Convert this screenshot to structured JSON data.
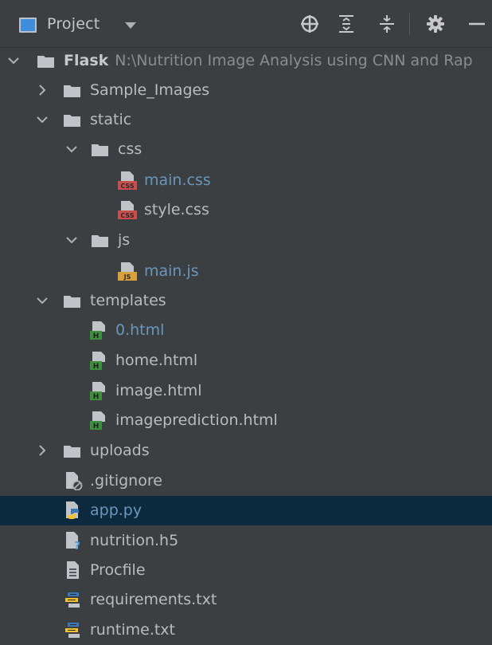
{
  "panel": {
    "title": "Project"
  },
  "toolbar": {
    "icons": [
      "crosshair-icon",
      "expand-all-icon",
      "collapse-all-icon",
      "gear-icon",
      "minimize-icon"
    ]
  },
  "tree": {
    "root": {
      "name": "Flask",
      "path": "N:\\Nutrition Image Analysis using CNN and Rap"
    },
    "items": [
      {
        "label": "Sample_Images"
      },
      {
        "label": "static"
      },
      {
        "label": "css"
      },
      {
        "label": "main.css"
      },
      {
        "label": "style.css"
      },
      {
        "label": "js"
      },
      {
        "label": "main.js"
      },
      {
        "label": "templates"
      },
      {
        "label": "0.html"
      },
      {
        "label": "home.html"
      },
      {
        "label": "image.html"
      },
      {
        "label": "imageprediction.html"
      },
      {
        "label": "uploads"
      },
      {
        "label": ".gitignore"
      },
      {
        "label": "app.py"
      },
      {
        "label": "nutrition.h5"
      },
      {
        "label": "Procfile"
      },
      {
        "label": "requirements.txt"
      },
      {
        "label": "runtime.txt"
      }
    ],
    "badges": {
      "css": "CSS",
      "js": "JS",
      "html": "H"
    }
  },
  "colors": {
    "background": "#3c3f41",
    "selection": "#0d293e",
    "text": "#bbbbbb",
    "modified_text": "#6897bb",
    "css_badge": "#c94f4f",
    "js_badge": "#d9a13b",
    "html_badge": "#3d8f3d"
  }
}
